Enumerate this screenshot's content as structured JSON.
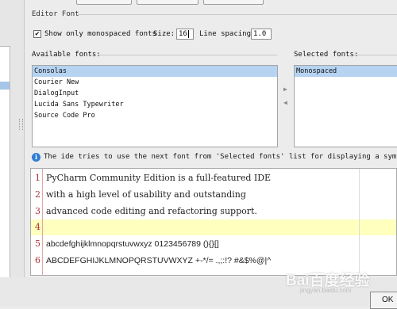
{
  "editor_font": {
    "section_title": "Editor Font",
    "monospaced_checked": true,
    "monospaced_label": "Show only monospaced fonts",
    "size_label": "Size:",
    "size_value": "16",
    "line_spacing_label": "Line spacing:",
    "line_spacing_value": "1.0"
  },
  "available_fonts": {
    "label": "Available fonts:",
    "items": [
      "Consolas",
      "Courier New",
      "DialogInput",
      "Lucida Sans Typewriter",
      "Source Code Pro"
    ],
    "selected_index": 0
  },
  "selected_fonts": {
    "label": "Selected fonts:",
    "items": [
      "Monospaced"
    ],
    "selected_index": 0
  },
  "info": {
    "text": "The ide tries to use the next font from 'Selected fonts' list for displaying a symbol if th"
  },
  "preview": {
    "lines": [
      {
        "num": "1",
        "text": "PyCharm Community Edition is a full-featured IDE"
      },
      {
        "num": "2",
        "text": "with a high level of usability and outstanding"
      },
      {
        "num": "3",
        "text": "advanced code editing and refactoring support."
      },
      {
        "num": "4",
        "text": ""
      },
      {
        "num": "5",
        "text": "abcdefghijklmnopqrstuvwxyz 0123456789 (){}[]"
      },
      {
        "num": "6",
        "text": "ABCDEFGHIJKLMNOPQRSTUVWXYZ +-*/= .,;:!? #&$%@|^"
      }
    ],
    "current_line": 4
  },
  "footer": {
    "ok_label": "OK"
  },
  "watermark": {
    "main": "Bai百度经验",
    "sub": "jingyan.baidu.com"
  },
  "colors": {
    "selection": "#b6d3f2",
    "current_line": "#ffffbe",
    "line_number": "#b03030",
    "info_icon": "#2f7cd3"
  }
}
